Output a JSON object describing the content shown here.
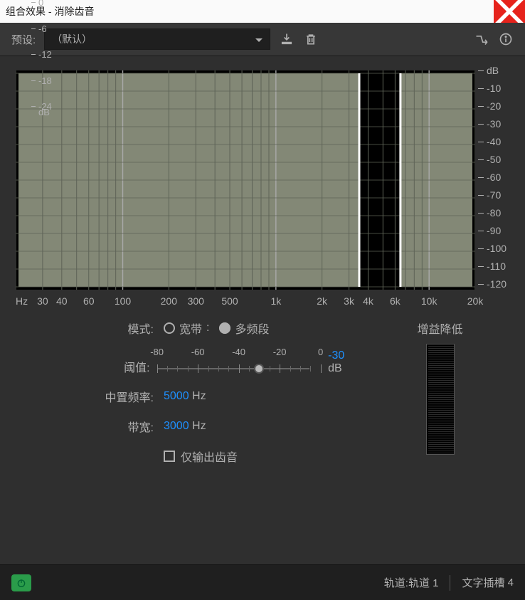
{
  "titlebar": {
    "title": "组合效果 - 消除齿音"
  },
  "presetbar": {
    "label": "预设:",
    "selected": "（默认）"
  },
  "chart_data": {
    "type": "spectrum-display",
    "x_scale": "log",
    "x_ticks_hz": [
      30,
      40,
      60,
      100,
      200,
      300,
      500,
      1000,
      2000,
      3000,
      4000,
      6000,
      10000,
      20000
    ],
    "x_tick_labels": [
      "30",
      "40",
      "60",
      "100",
      "200",
      "300",
      "500",
      "1k",
      "2k",
      "3k",
      "4k",
      "6k",
      "10k",
      "20k"
    ],
    "x_unit_label": "Hz",
    "y_label": "dB",
    "y_ticks_db": [
      -10,
      -20,
      -30,
      -40,
      -50,
      -60,
      -70,
      -80,
      -90,
      -100,
      -110,
      -120
    ],
    "ylim": [
      -120,
      0
    ],
    "center_freq_hz": 5000,
    "bandwidth_hz": 3000,
    "band_low_hz": 3500,
    "band_high_hz": 6500
  },
  "controls": {
    "mode_label": "模式:",
    "mode_options": {
      "broadband": "宽带",
      "multiband": "多频段"
    },
    "mode_selected": "broadband",
    "threshold_label": "阈值:",
    "threshold_ticks": [
      -80,
      -60,
      -40,
      -20,
      0
    ],
    "threshold_value": -30,
    "threshold_unit": "dB",
    "center_freq_label": "中置频率:",
    "center_freq_value": 5000,
    "center_freq_unit": "Hz",
    "bandwidth_label": "带宽:",
    "bandwidth_value": 3000,
    "bandwidth_unit": "Hz",
    "output_only_label": "仅输出齿音",
    "output_only_checked": false
  },
  "gain_reduction": {
    "title": "增益降低",
    "ticks": [
      0,
      -6,
      -12,
      -18,
      -24
    ],
    "unit": "dB"
  },
  "footer": {
    "track_label": "轨道:",
    "track_value": "轨道 1",
    "slot_label": "文字插槽",
    "slot_value": "4"
  }
}
